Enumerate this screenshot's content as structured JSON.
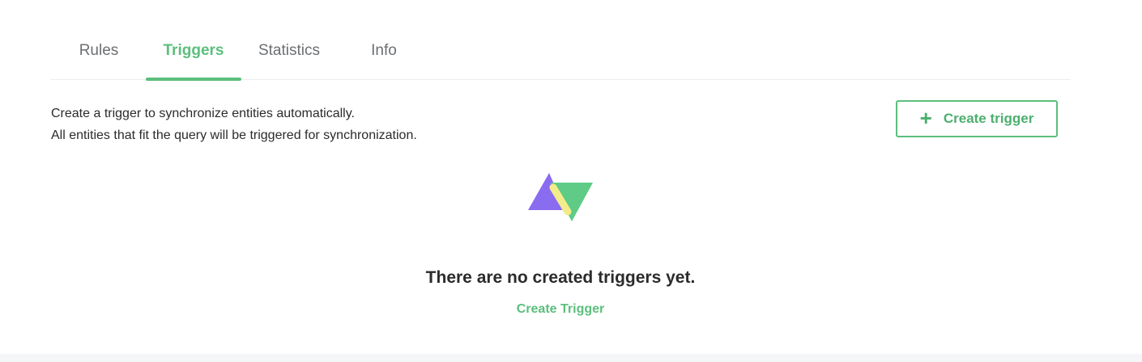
{
  "tabs": [
    {
      "label": "Rules",
      "active": false
    },
    {
      "label": "Triggers",
      "active": true
    },
    {
      "label": "Statistics",
      "active": false
    },
    {
      "label": "Info",
      "active": false
    }
  ],
  "description": {
    "line1": "Create a trigger to synchronize entities automatically.",
    "line2": "All entities that fit the query will be triggered for synchronization."
  },
  "create_button": {
    "icon": "plus-icon",
    "label": "Create trigger"
  },
  "empty_state": {
    "illustration": "triangles-logo-icon",
    "title": "There are no created triggers yet.",
    "link_label": "Create Trigger"
  },
  "colors": {
    "accent": "#5bbf7c",
    "purple": "#8a6cf0",
    "green": "#5fcb86",
    "yellow": "#f3ec8a"
  }
}
